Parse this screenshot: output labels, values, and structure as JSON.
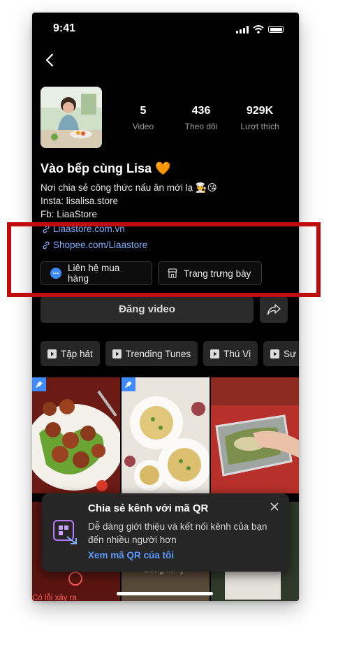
{
  "status_bar": {
    "time": "9:41"
  },
  "profile": {
    "stats": [
      {
        "value": "5",
        "label": "Video"
      },
      {
        "value": "436",
        "label": "Theo dõi"
      },
      {
        "value": "929K",
        "label": "Lượt thích"
      }
    ],
    "name": "Vào bếp cùng Lisa",
    "name_emoji": "🧡",
    "bio": [
      "Nơi chia sẻ công thức nấu ăn mới lạ 👨‍🍳😘",
      "Insta: lisalisa.store",
      "Fb: LiaaStore"
    ],
    "links": [
      "Liaastore.com.vn",
      "Shopee.com/Liaastore"
    ]
  },
  "actions": {
    "contact_label": "Liên hệ mua hàng",
    "showcase_label": "Trang trưng bày",
    "upload_label": "Đăng video"
  },
  "playlists": [
    "Tập hát",
    "Trending Tunes",
    "Thú Vị",
    "Sự"
  ],
  "grid": {
    "processing_label": "Đang xử lý",
    "error_label": "Có lỗi xảy ra"
  },
  "toast": {
    "title": "Chia sẻ kênh với mã QR",
    "body": "Dễ dàng giới thiệu và kết nối kênh của bạn đến nhiều người hơn",
    "link": "Xem mã QR của tôi"
  },
  "colors": {
    "background": "#000000",
    "link": "#7fb0ff",
    "accent_link": "#5b9bff",
    "highlight_frame": "#c00c0c",
    "pin_badge": "#3d8bff"
  },
  "icons": [
    "back-arrow-icon",
    "link-icon",
    "chat-icon",
    "store-icon",
    "share-icon",
    "playlist-icon",
    "pin-icon",
    "qr-icon",
    "close-icon"
  ]
}
